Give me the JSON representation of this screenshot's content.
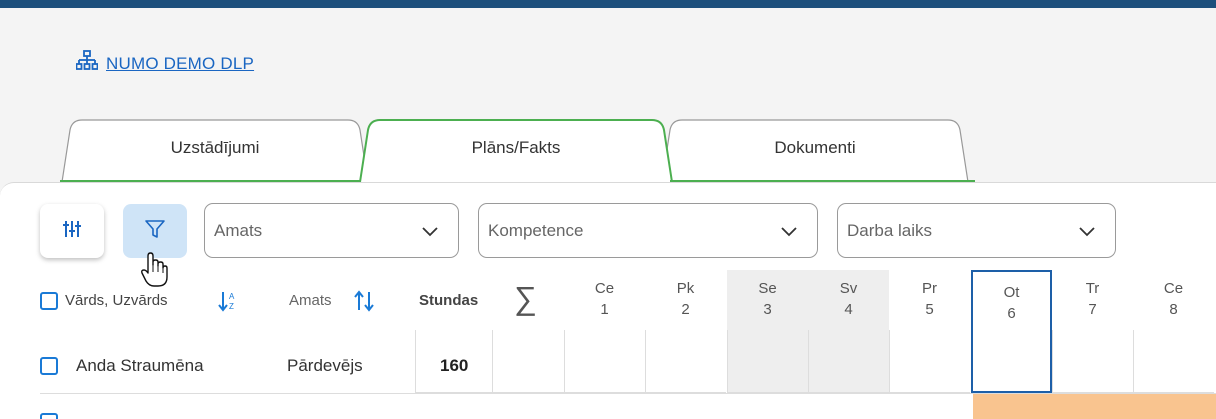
{
  "org": {
    "link_text": "NUMO DEMO DLP",
    "icon": "sitemap-icon"
  },
  "tabs": [
    {
      "label": "Uzstādījumi",
      "active": false
    },
    {
      "label": "Plāns/Fakts",
      "active": true
    },
    {
      "label": "Dokumenti",
      "active": false
    }
  ],
  "toolbar": {
    "settings_icon": "sliders-icon",
    "filter_icon": "filter-icon",
    "filters": [
      {
        "placeholder": "Amats"
      },
      {
        "placeholder": "Kompetence"
      },
      {
        "placeholder": "Darba laiks"
      }
    ]
  },
  "columns": {
    "name": "Vārds, Uzvārds",
    "role": "Amats",
    "hours": "Stundas",
    "sum_symbol": "∑"
  },
  "days": [
    {
      "dow": "Ce",
      "num": "1",
      "weekend": false
    },
    {
      "dow": "Pk",
      "num": "2",
      "weekend": false
    },
    {
      "dow": "Se",
      "num": "3",
      "weekend": true
    },
    {
      "dow": "Sv",
      "num": "4",
      "weekend": true
    },
    {
      "dow": "Pr",
      "num": "5",
      "weekend": false
    },
    {
      "dow": "Ot",
      "num": "6",
      "weekend": false,
      "today": true
    },
    {
      "dow": "Tr",
      "num": "7",
      "weekend": false
    },
    {
      "dow": "Ce",
      "num": "8",
      "weekend": false
    }
  ],
  "rows": [
    {
      "name": "Anda Straumēna",
      "role": "Pārdevējs",
      "hours": "160"
    }
  ],
  "colors": {
    "accent": "#1a7ad6",
    "active_tab": "#4caf50",
    "today": "#1d5fa8",
    "highlight": "#f9c48f"
  }
}
